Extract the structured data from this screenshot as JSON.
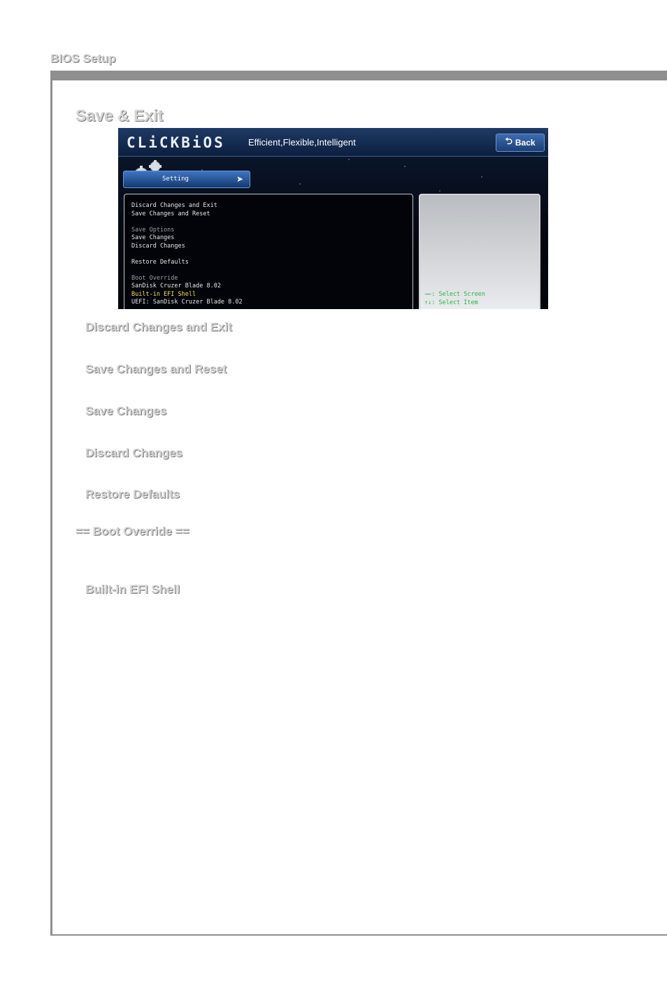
{
  "page": {
    "header": "BIOS Setup",
    "section_title": "Save & Exit"
  },
  "bios": {
    "logo": "CLiCKBiOS",
    "tagline": "Efficient,Flexible,Intelligent",
    "back_label": "Back",
    "active_tab": "Setting",
    "menu_items": [
      {
        "label": "Discard Changes and Exit",
        "style": "normal"
      },
      {
        "label": "Save Changes and Reset",
        "style": "normal"
      },
      {
        "label": "",
        "style": "normal"
      },
      {
        "label": "Save Options",
        "style": "header"
      },
      {
        "label": "Save Changes",
        "style": "normal"
      },
      {
        "label": "Discard Changes",
        "style": "normal"
      },
      {
        "label": "",
        "style": "normal"
      },
      {
        "label": "Restore Defaults",
        "style": "normal"
      },
      {
        "label": "",
        "style": "normal"
      },
      {
        "label": "Boot Override",
        "style": "header"
      },
      {
        "label": "SanDisk Cruzer Blade 8.02",
        "style": "normal"
      },
      {
        "label": "Built-in EFI Shell",
        "style": "selected"
      },
      {
        "label": "UEFI: SanDisk Cruzer Blade 8.02",
        "style": "normal"
      }
    ],
    "help_keys": [
      "→←: Select Screen",
      "↑↓: Select Item"
    ],
    "colors": {
      "selected_item": "#f0e15a",
      "help_text": "#2fb24a",
      "tab_blue": "#3d75c2"
    }
  },
  "items": {
    "discard_changes_and_exit": "Discard Changes and Exit",
    "save_changes_and_reset": "Save Changes and Reset",
    "save_changes": "Save Changes",
    "discard_changes": "Discard Changes",
    "restore_defaults": "Restore Defaults",
    "boot_override": "== Boot Override ==",
    "builtin_efi_shell": "Built-in EFI Shell"
  }
}
